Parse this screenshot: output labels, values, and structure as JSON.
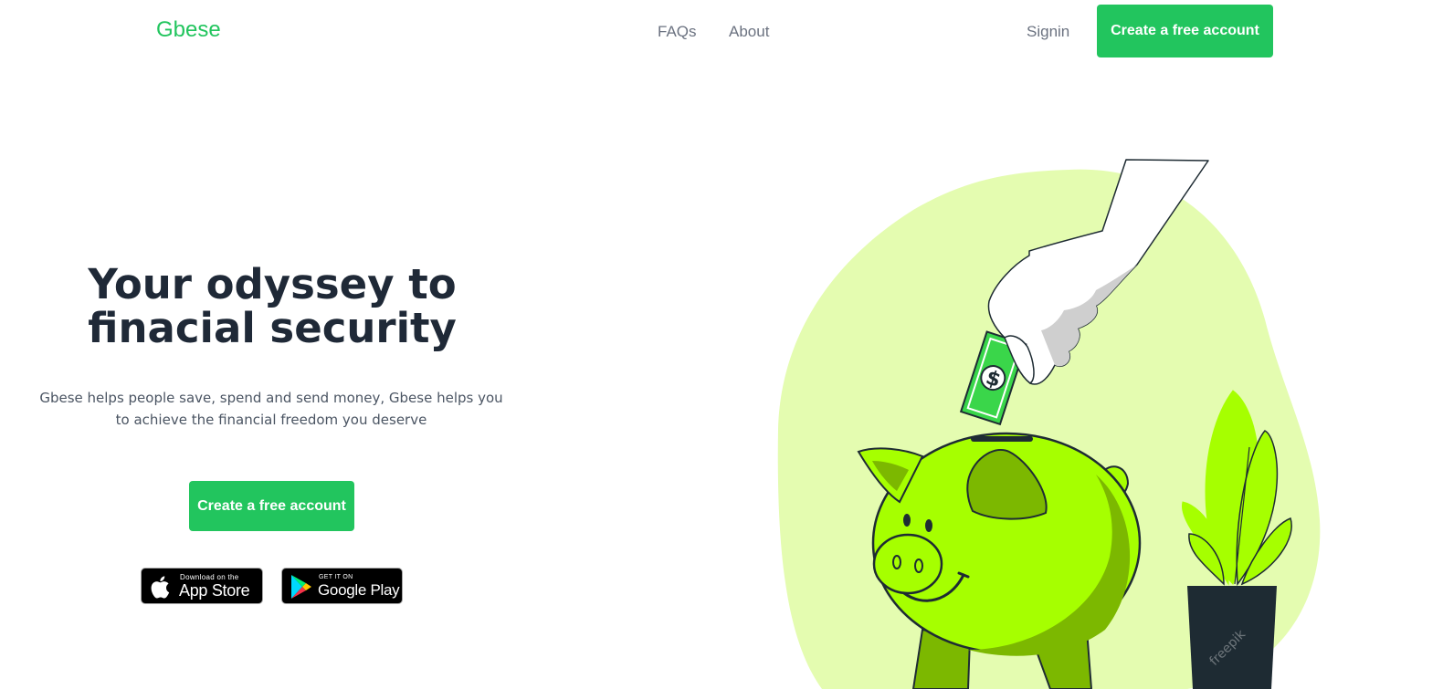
{
  "header": {
    "brand": "Gbese",
    "nav": [
      {
        "label": "FAQs"
      },
      {
        "label": "About"
      }
    ],
    "signin_label": "Signin",
    "cta_label": "Create a free account"
  },
  "hero": {
    "title": "Your odyssey to finacial security",
    "subtitle": "Gbese helps people save, spend and send money, Gbese helps you to achieve the financial freedom you deserve",
    "cta_label": "Create a free account"
  },
  "stores": {
    "apple": {
      "small": "Download on the",
      "big": "App Store",
      "icon": "apple-icon"
    },
    "google": {
      "small": "GET IT ON",
      "big": "Google Play",
      "icon": "google-play-icon"
    }
  },
  "illustration": {
    "subject": "hand-dropping-money-into-piggy-bank",
    "watermark": "freepik"
  },
  "colors": {
    "brand": "#22c55e",
    "heading": "#1f2937",
    "body_text": "#4b5563",
    "nav_text": "#6b7280",
    "blob": "#e4fcb0",
    "pig": "#a6ff00",
    "pot": "#1e2b33"
  }
}
